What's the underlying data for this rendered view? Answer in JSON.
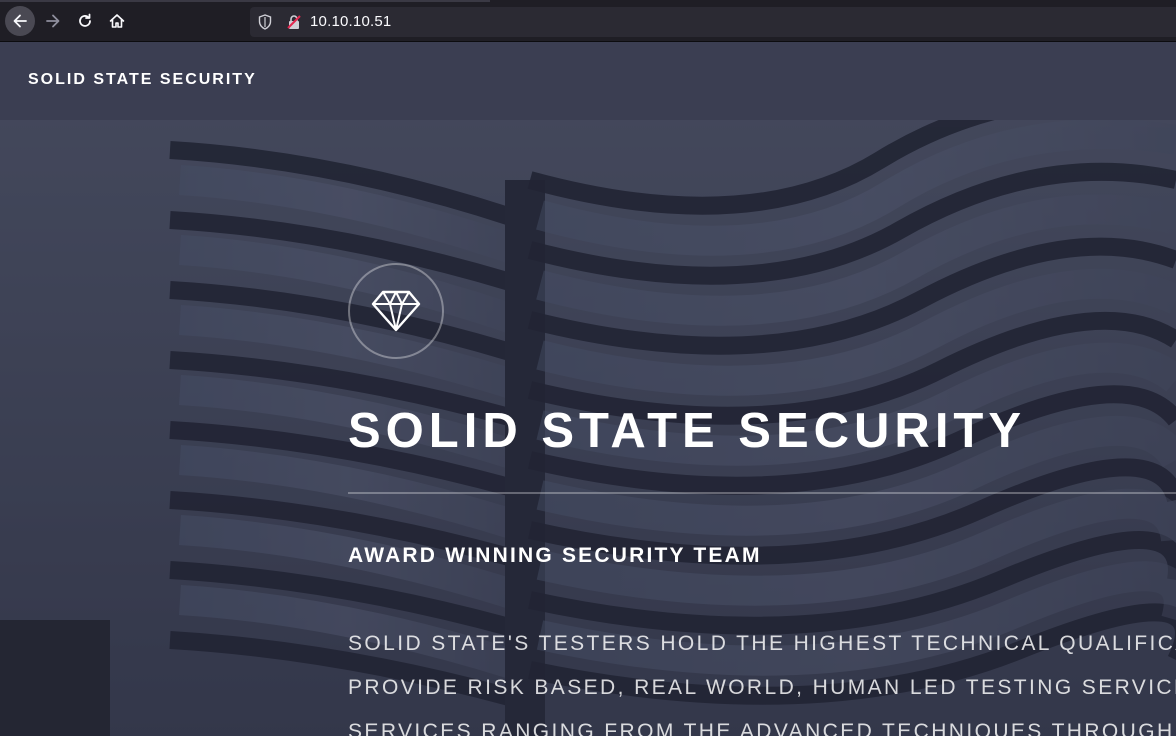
{
  "browser": {
    "url": "10.10.10.51",
    "icons": {
      "back": "arrow-left-icon",
      "forward": "arrow-right-icon",
      "reload": "reload-icon",
      "home": "home-icon",
      "tracking": "shield-icon",
      "insecure": "insecure-lock-icon"
    }
  },
  "header": {
    "logo": "SOLID STATE SECURITY"
  },
  "hero": {
    "icon": "diamond-icon",
    "title": "SOLID STATE SECURITY",
    "subtitle": "AWARD WINNING SECURITY TEAM",
    "lines": [
      "SOLID STATE'S TESTERS HOLD THE HIGHEST TECHNICAL QUALIFICA",
      "PROVIDE RISK BASED, REAL WORLD, HUMAN LED TESTING SERVICE",
      "SERVICES RANGING FROM THE ADVANCED TECHNIQUES THROUGH"
    ]
  },
  "colors": {
    "header_bg": "#3b3e52",
    "hero_overlay": "#26293a",
    "browser_bg": "#1f1e25",
    "url_bg": "#2b2a33"
  }
}
